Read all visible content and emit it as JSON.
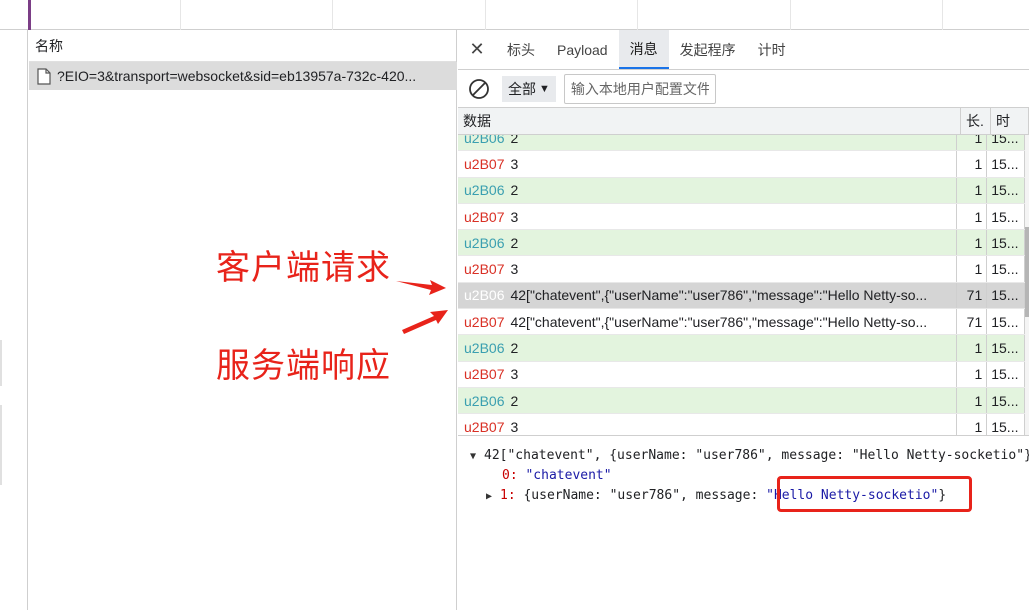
{
  "name_panel": {
    "header": "名称",
    "request_name": "?EIO=3&transport=websocket&sid=eb13957a-732c-420..."
  },
  "tabs": {
    "close": "✕",
    "items": [
      {
        "label": "标头"
      },
      {
        "label": "Payload"
      },
      {
        "label": "消息",
        "active": true
      },
      {
        "label": "发起程序"
      },
      {
        "label": "计时"
      }
    ]
  },
  "filter": {
    "select_value": "全部",
    "caret": "▼",
    "placeholder": "输入本地用户配置文件"
  },
  "grid": {
    "headers": {
      "data": "数据",
      "length": "长.",
      "time": "时"
    },
    "rows": [
      {
        "dir": "sent",
        "tag": "u2B06",
        "text": "2",
        "length": "1",
        "time": "15..."
      },
      {
        "dir": "recv",
        "tag": "u2B07",
        "text": "3",
        "length": "1",
        "time": "15..."
      },
      {
        "dir": "sent",
        "tag": "u2B06",
        "text": "2",
        "length": "1",
        "time": "15..."
      },
      {
        "dir": "recv",
        "tag": "u2B07",
        "text": "3",
        "length": "1",
        "time": "15..."
      },
      {
        "dir": "sent",
        "tag": "u2B06",
        "text": "2",
        "length": "1",
        "time": "15..."
      },
      {
        "dir": "recv",
        "tag": "u2B07",
        "text": "3",
        "length": "1",
        "time": "15..."
      },
      {
        "dir": "selected",
        "tag": "u2B06",
        "text": "42[\"chatevent\",{\"userName\":\"user786\",\"message\":\"Hello Netty-so...",
        "length": "71",
        "time": "15..."
      },
      {
        "dir": "recv",
        "tag": "u2B07",
        "text": "42[\"chatevent\",{\"userName\":\"user786\",\"message\":\"Hello Netty-so...",
        "length": "71",
        "time": "15..."
      },
      {
        "dir": "sent",
        "tag": "u2B06",
        "text": "2",
        "length": "1",
        "time": "15..."
      },
      {
        "dir": "recv",
        "tag": "u2B07",
        "text": "3",
        "length": "1",
        "time": "15..."
      },
      {
        "dir": "sent",
        "tag": "u2B06",
        "text": "2",
        "length": "1",
        "time": "15..."
      },
      {
        "dir": "recv",
        "tag": "u2B07",
        "text": "3",
        "length": "1",
        "time": "15..."
      }
    ]
  },
  "preview": {
    "line1": "42[\"chatevent\", {userName: \"user786\", message: \"Hello Netty-socketio\"}]",
    "line2_key": "0:",
    "line2_val": "\"chatevent\"",
    "line3_key": "1:",
    "line3_rest": "{userName: \"user786\", message: ",
    "line3_msg": "\"Hello Netty-socketio\"",
    "line3_end": "}"
  },
  "annotations": {
    "client_request": "客户端请求",
    "server_response": "服务端响应"
  },
  "colors": {
    "annotation_red": "#e8231a",
    "sent_row_bg": "#e3f4de",
    "sent_tag": "#3a9fb0",
    "recv_tag": "#d93025",
    "active_tab_underline": "#1a73e8"
  }
}
